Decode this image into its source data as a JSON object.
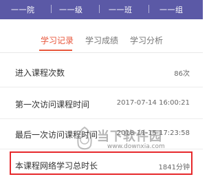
{
  "header": {
    "breadcrumbs": [
      "一一院",
      "一一级",
      "一一班",
      "一一组"
    ]
  },
  "tabs": [
    {
      "label": "学习记录",
      "active": true
    },
    {
      "label": "学习成绩",
      "active": false
    },
    {
      "label": "学习分析",
      "active": false
    }
  ],
  "rows": [
    {
      "label": "进入课程次数",
      "value": "86次"
    },
    {
      "label": "第一次访问课程时间",
      "value": "2017-07-14 16:00:21"
    },
    {
      "label": "最后一次访问课程时间",
      "value": "2018-11-15 17:23:58"
    },
    {
      "label": "本课程网络学习总时长",
      "value": "1841分钟"
    }
  ],
  "watermark": {
    "brand": "当下软件园",
    "url": "www.downxia.com"
  },
  "colors": {
    "header_bg": "#5b59a6",
    "accent": "#e8573c",
    "highlight": "#e6282b"
  }
}
